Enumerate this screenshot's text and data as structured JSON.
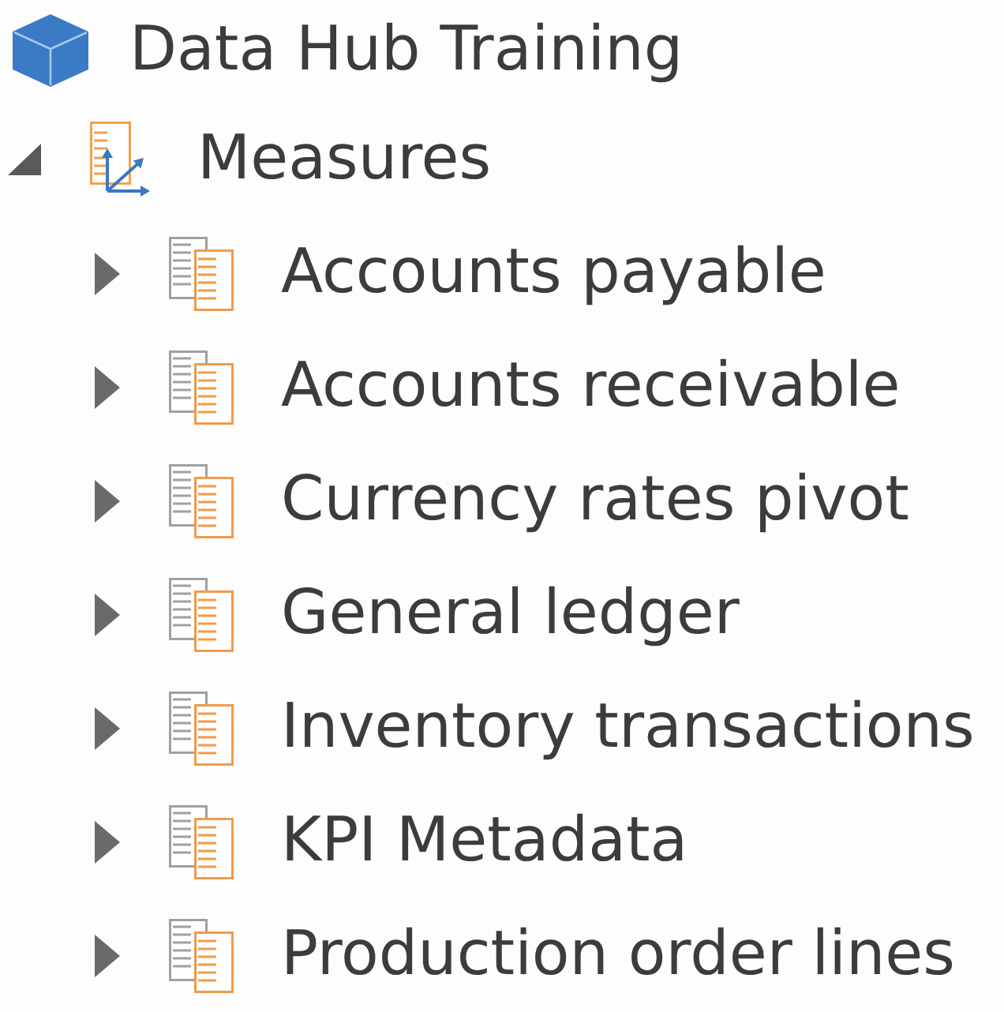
{
  "tree": [
    {
      "label": "Data Hub Training",
      "kind": "model",
      "children": [
        {
          "label": "Measures",
          "kind": "folder",
          "expanded": true,
          "children": [
            {
              "label": "Accounts payable",
              "kind": "table",
              "expanded": false
            },
            {
              "label": "Accounts receivable",
              "kind": "table",
              "expanded": false
            },
            {
              "label": "Currency rates pivot",
              "kind": "table",
              "expanded": false
            },
            {
              "label": "General ledger",
              "kind": "table",
              "expanded": false
            },
            {
              "label": "Inventory transactions",
              "kind": "table",
              "expanded": false
            },
            {
              "label": "KPI Metadata",
              "kind": "table",
              "expanded": false
            },
            {
              "label": "Production order lines",
              "kind": "table",
              "expanded": false
            }
          ]
        }
      ]
    }
  ]
}
